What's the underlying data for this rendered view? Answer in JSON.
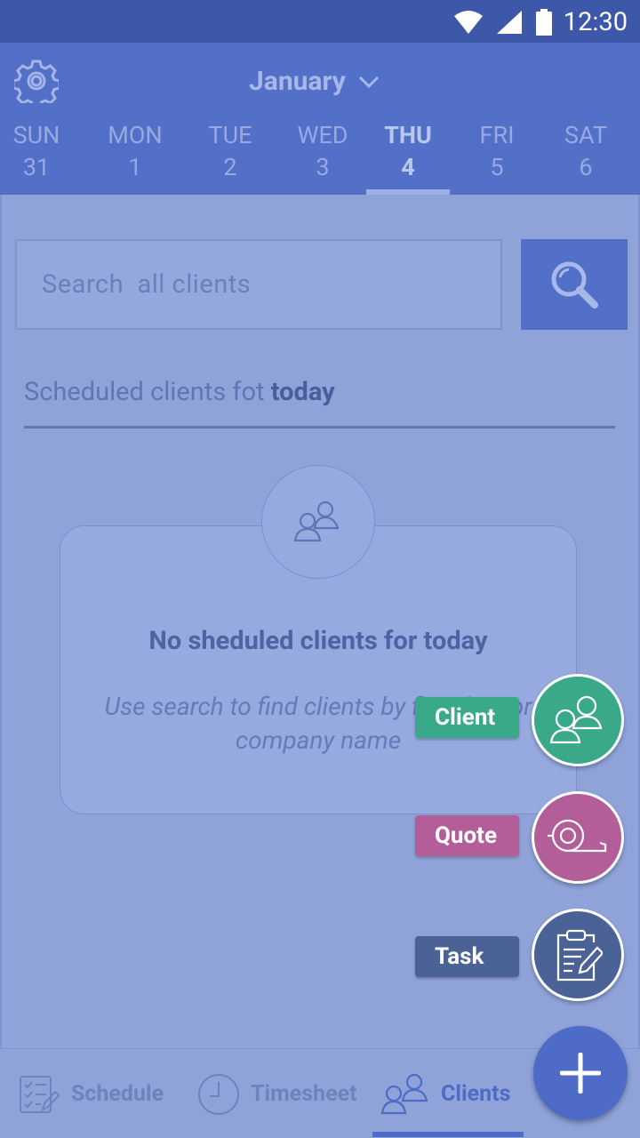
{
  "status_bar": {
    "time": "12:30",
    "icons": [
      "wifi-icon",
      "signal-icon",
      "battery-icon"
    ]
  },
  "header": {
    "month": "January",
    "days": [
      {
        "name": "SUN",
        "num": "31",
        "active": false
      },
      {
        "name": "MON",
        "num": "1",
        "active": false
      },
      {
        "name": "TUE",
        "num": "2",
        "active": false
      },
      {
        "name": "WED",
        "num": "3",
        "active": false
      },
      {
        "name": "THU",
        "num": "4",
        "active": true
      },
      {
        "name": "FRI",
        "num": "5",
        "active": false
      },
      {
        "name": "SAT",
        "num": "6",
        "active": false
      }
    ]
  },
  "search": {
    "placeholder": "Search  all clients",
    "value": ""
  },
  "section": {
    "title_prefix": "Scheduled clients fot ",
    "title_bold": "today"
  },
  "empty_state": {
    "title": "No sheduled clients for today",
    "description": "Use search to find clients by first, last or company name"
  },
  "fab_menu": [
    {
      "label": "Client",
      "icon": "clients-icon",
      "color": "#3aa98a"
    },
    {
      "label": "Quote",
      "icon": "tape-measure-icon",
      "color": "#b35e98"
    },
    {
      "label": "Task",
      "icon": "clipboard-edit-icon",
      "color": "#4a6296"
    }
  ],
  "bottom_nav": [
    {
      "label": "Schedule",
      "icon": "schedule-icon",
      "active": false
    },
    {
      "label": "Timesheet",
      "icon": "clock-icon",
      "active": false
    },
    {
      "label": "Clients",
      "icon": "clients-icon",
      "active": true
    }
  ],
  "colors": {
    "primary": "#5270c8",
    "status_bar": "#3d58a8",
    "overlay": "#8fa3d9"
  }
}
